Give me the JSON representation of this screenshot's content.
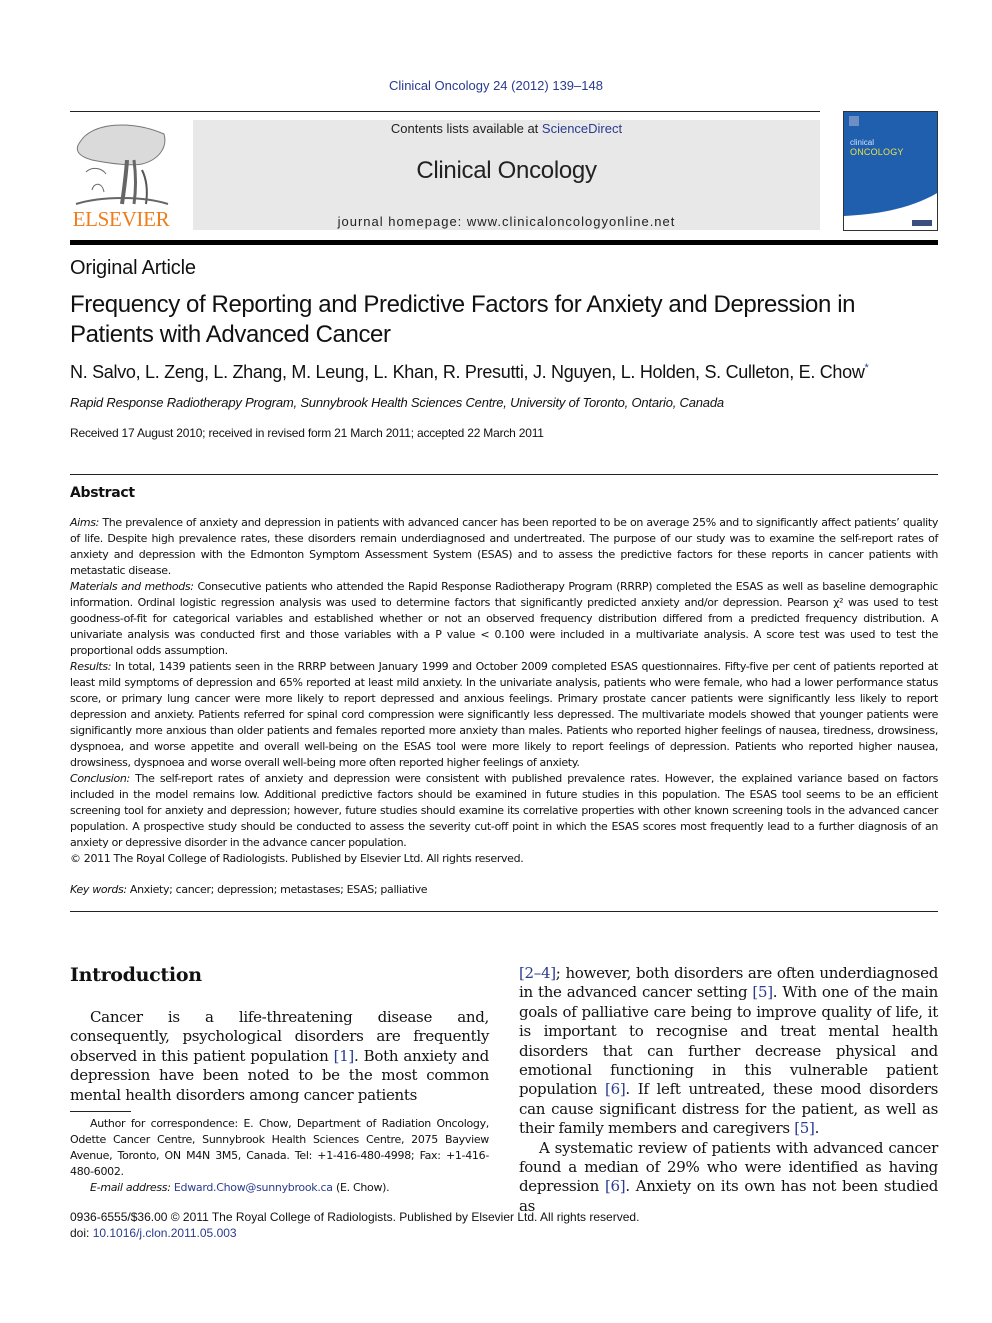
{
  "header": {
    "citation": "Clinical Oncology 24 (2012) 139–148",
    "publisher_logo_text": "ELSEVIER",
    "contents_prefix": "Contents lists available at ",
    "contents_link": "ScienceDirect",
    "journal_name": "Clinical Oncology",
    "homepage_label": "journal homepage: www.clinicaloncologyonline.net",
    "cover_title_line1": "clinical",
    "cover_title_line2": "ONCOLOGY",
    "colors": {
      "publisher_orange": "#ef7d1a",
      "link_blue": "#2a3b8f",
      "masthead_gray": "#e8e8e8",
      "cover_blue": "#1f5fae"
    }
  },
  "article": {
    "type": "Original Article",
    "title": "Frequency of Reporting and Predictive Factors for Anxiety and Depression in Patients with Advanced Cancer",
    "authors": "N. Salvo, L. Zeng, L. Zhang, M. Leung, L. Khan, R. Presutti, J. Nguyen, L. Holden, S. Culleton, E. Chow",
    "corresponding_mark": "*",
    "affiliation": "Rapid Response Radiotherapy Program, Sunnybrook Health Sciences Centre, University of Toronto, Ontario, Canada",
    "received": "Received 17 August 2010; received in revised form 21 March 2011; accepted 22 March 2011"
  },
  "abstract": {
    "heading": "Abstract",
    "sections": [
      {
        "label": "Aims:",
        "text": " The prevalence of anxiety and depression in patients with advanced cancer has been reported to be on average 25% and to significantly affect patients’ quality of life. Despite high prevalence rates, these disorders remain underdiagnosed and undertreated. The purpose of our study was to examine the self-report rates of anxiety and depression with the Edmonton Symptom Assessment System (ESAS) and to assess the predictive factors for these reports in cancer patients with metastatic disease."
      },
      {
        "label": "Materials and methods:",
        "text": " Consecutive patients who attended the Rapid Response Radiotherapy Program (RRRP) completed the ESAS as well as baseline demographic information. Ordinal logistic regression analysis was used to determine factors that significantly predicted anxiety and/or depression. Pearson χ² was used to test goodness-of-fit for categorical variables and established whether or not an observed frequency distribution differed from a predicted frequency distribution. A univariate analysis was conducted first and those variables with a P value < 0.100 were included in a multivariate analysis. A score test was used to test the proportional odds assumption."
      },
      {
        "label": "Results:",
        "text": " In total, 1439 patients seen in the RRRP between January 1999 and October 2009 completed ESAS questionnaires. Fifty-five per cent of patients reported at least mild symptoms of depression and 65% reported at least mild anxiety. In the univariate analysis, patients who were female, who had a lower performance status score, or primary lung cancer were more likely to report depressed and anxious feelings. Primary prostate cancer patients were significantly less likely to report depression and anxiety. Patients referred for spinal cord compression were significantly less depressed. The multivariate models showed that younger patients were significantly more anxious than older patients and females reported more anxiety than males. Patients who reported higher feelings of nausea, tiredness, drowsiness, dyspnoea, and worse appetite and overall well-being on the ESAS tool were more likely to report feelings of depression. Patients who reported higher nausea, drowsiness, dyspnoea and worse overall well-being more often reported higher feelings of anxiety."
      },
      {
        "label": "Conclusion:",
        "text": " The self-report rates of anxiety and depression were consistent with published prevalence rates. However, the explained variance based on factors included in the model remains low. Additional predictive factors should be examined in future studies in this population. The ESAS tool seems to be an efficient screening tool for anxiety and depression; however, future studies should examine its correlative properties with other known screening tools in the advanced cancer population. A prospective study should be conducted to assess the severity cut-off point in which the ESAS scores most frequently lead to a further diagnosis of an anxiety or depressive disorder in the advance cancer population."
      }
    ],
    "copyright": "© 2011 The Royal College of Radiologists. Published by Elsevier Ltd. All rights reserved.",
    "keywords_label": "Key words:",
    "keywords": " Anxiety; cancer; depression; metastases; ESAS; palliative"
  },
  "introduction": {
    "heading": "Introduction",
    "p1_a": "Cancer is a life-threatening disease and, consequently, psychological disorders are frequently observed in this patient population ",
    "p1_ref1": "[1]",
    "p1_b": ". Both anxiety and depression have been noted to be the most common mental health disorders among cancer patients ",
    "p1_ref2": "[2–4]",
    "p1_c": "; however, both disorders are often underdiagnosed in the advanced cancer setting ",
    "p1_ref3": "[5]",
    "p1_d": ". With one of the main goals of palliative care being to improve quality of life, it is important to recognise and treat mental health disorders that can further decrease physical and emotional functioning in this vulnerable patient population ",
    "p1_ref4": "[6]",
    "p1_e": ". If left untreated, these mood disorders can cause significant distress for the patient, as well as their family members and caregivers ",
    "p1_ref5": "[5]",
    "p1_f": ".",
    "p2_a": "A systematic review of patients with advanced cancer found a median of 29% who were identified as having depression ",
    "p2_ref1": "[6]",
    "p2_b": ". Anxiety on its own has not been studied as"
  },
  "footnote": {
    "correspondence": "Author for correspondence: E. Chow, Department of Radiation Oncology, Odette Cancer Centre, Sunnybrook Health Sciences Centre, 2075 Bayview Avenue, Toronto, ON M4N 3M5, Canada. Tel: +1-416-480-4998; Fax: +1-416-480-6002.",
    "email_label": "E-mail address:",
    "email": "Edward.Chow@sunnybrook.ca",
    "email_suffix": " (E. Chow)."
  },
  "footer": {
    "issn_line": "0936-6555/$36.00 © 2011 The Royal College of Radiologists. Published by Elsevier Ltd. All rights reserved.",
    "doi_label": "doi: ",
    "doi": "10.1016/j.clon.2011.05.003"
  }
}
